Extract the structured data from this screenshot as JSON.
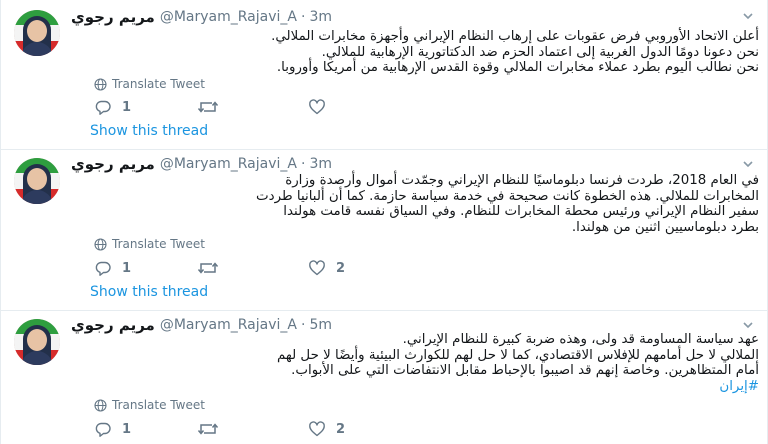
{
  "tweets": [
    {
      "name": "مريم رجوي",
      "handle": "@Maryam_Rajavi_A",
      "separator": "·",
      "time": "3m",
      "lines": [
        "أعلن الاتحاد الأوروبي فرض عقوبات على إرهاب النظام الإيراني وأجهزة مخابرات الملالي.",
        "نحن دعونا دومًا الدول الغربية إلى اعتماد الحزم ضد الدكتاتورية الإرهابية للملالي.",
        "نحن نطالب اليوم بطرد عملاء مخابرات الملالي وقوة القدس الإرهابية من أمريكا وأوروبا."
      ],
      "translate_label": "Translate Tweet",
      "reply_count": "1",
      "retweet_count": "",
      "like_count": "",
      "show_thread": "Show this thread"
    },
    {
      "name": "مريم رجوي",
      "handle": "@Maryam_Rajavi_A",
      "separator": "·",
      "time": "3m",
      "lines": [
        "في العام 2018، طردت فرنسا دبلوماسيًا للنظام الإيراني وجمّدت أموال وأرصدة وزارة",
        "المخابرات للملالي. هذه الخطوة كانت صحيحة في خدمة سياسة حازمة. كما أن ألبانيا طردت",
        "سفير النظام الإيراني ورئيس محطة المخابرات للنظام. وفي السياق نفسه قامت هولندا",
        "بطرد دبلوماسيين اثنين من هولندا."
      ],
      "translate_label": "Translate Tweet",
      "reply_count": "1",
      "retweet_count": "",
      "like_count": "2",
      "show_thread": "Show this thread"
    },
    {
      "name": "مريم رجوي",
      "handle": "@Maryam_Rajavi_A",
      "separator": "·",
      "time": "5m",
      "lines": [
        "عهد سياسة المساومة قد ولى، وهذه ضربة كبيرة للنظام الإيراني.",
        "الملالي لا حل أمامهم للإفلاس الاقتصادي، كما لا حل لهم للكوارث البيئية وأيضًا لا حل لهم",
        "أمام المتظاهرين. وخاصة إنهم قد اصيبوا بالإحباط مقابل الانتفاضات التي على الأبواب."
      ],
      "hashtag": "#إيران",
      "translate_label": "Translate Tweet",
      "reply_count": "1",
      "retweet_count": "",
      "like_count": "2"
    }
  ],
  "colors": {
    "link": "#1b95e0",
    "muted": "#657786",
    "text": "#14171a",
    "divider": "#e6ecf0"
  },
  "icons": {
    "avatar": "avatar-image",
    "caret": "chevron-down-icon",
    "translate": "globe-icon",
    "reply": "reply-icon",
    "retweet": "retweet-icon",
    "like": "heart-icon"
  }
}
